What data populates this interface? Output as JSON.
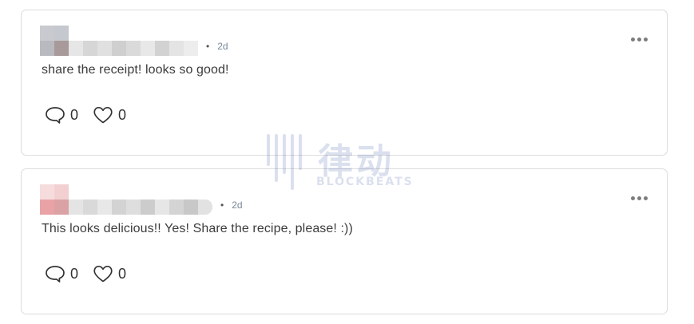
{
  "comments": [
    {
      "time": "2d",
      "separator": "•",
      "text": "share the receipt! looks so good!",
      "reply_count": "0",
      "like_count": "0",
      "avatar_colors": [
        "#c8cad0",
        "#b9b9c0",
        "#b0a0a6",
        "#a89a9a"
      ]
    },
    {
      "time": "2d",
      "separator": "•",
      "text": "This looks delicious!! Yes! Share the recipe, please! :))",
      "reply_count": "0",
      "like_count": "0",
      "avatar_colors": [
        "#f4d2d4",
        "#f0c4c6",
        "#e8a4a8",
        "#d8a0a4"
      ]
    }
  ],
  "icons": {
    "reply": "speech-bubble-icon",
    "like": "heart-icon",
    "more": "more-horizontal-icon"
  },
  "watermark": {
    "cn": "律动",
    "en": "BLOCKBEATS"
  }
}
